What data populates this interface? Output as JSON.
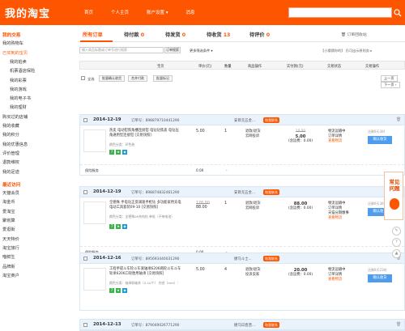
{
  "header": {
    "logo": "我的淘宝",
    "nav": [
      "首页",
      "个人主页",
      "账户设置 ▾",
      "消息"
    ],
    "search_placeholder": ""
  },
  "sidebar": [
    {
      "label": "我的交易",
      "kind": "sec"
    },
    {
      "label": "我的购物车",
      "kind": "sub0"
    },
    {
      "label": "已买到的宝贝",
      "kind": "act"
    },
    {
      "label": "我的拍卖",
      "kind": "sub"
    },
    {
      "label": "机票酒店保险",
      "kind": "sub"
    },
    {
      "label": "我的彩票",
      "kind": "sub"
    },
    {
      "label": "我的游戏",
      "kind": "sub"
    },
    {
      "label": "我的电子书",
      "kind": "sub"
    },
    {
      "label": "我的理财",
      "kind": "sub"
    },
    {
      "label": "购买过的店铺",
      "kind": "sub0"
    },
    {
      "label": "我的收藏",
      "kind": "sub0"
    },
    {
      "label": "我的积分",
      "kind": "sub0"
    },
    {
      "label": "我的优惠信息",
      "kind": "sub0"
    },
    {
      "label": "评价管理",
      "kind": "sub0"
    },
    {
      "label": "退款维权",
      "kind": "sub0"
    },
    {
      "label": "我的足迹",
      "kind": "sub0"
    },
    {
      "label": "最近访问",
      "kind": "sec"
    },
    {
      "label": "天猫会员",
      "kind": "sub0"
    },
    {
      "label": "淘金币",
      "kind": "sub0"
    },
    {
      "label": "爱淘宝",
      "kind": "sub0"
    },
    {
      "label": "聚划算",
      "kind": "sub0"
    },
    {
      "label": "爱逛街",
      "kind": "sub0"
    },
    {
      "label": "天天特价",
      "kind": "sub0"
    },
    {
      "label": "淘宝旅行",
      "kind": "sub0"
    },
    {
      "label": "喵鲜生",
      "kind": "sub0"
    },
    {
      "label": "品牌街",
      "kind": "sub0"
    },
    {
      "label": "淘宝商户",
      "kind": "sub0"
    }
  ],
  "tabs": [
    {
      "label": "所有订单",
      "num": ""
    },
    {
      "label": "待付款",
      "num": "0"
    },
    {
      "label": "待发货",
      "num": "0"
    },
    {
      "label": "待收货",
      "num": "13"
    },
    {
      "label": "待评价",
      "num": "0"
    }
  ],
  "recycle_label": "订单回收站",
  "filter": {
    "placeholder": "输入商品标题或订单号进行搜索",
    "button": "订单搜索",
    "more": "更多筛选条件 ▾",
    "right": "【小猜猜你的】 仍可出示原则务 ▸"
  },
  "columns": [
    "宝贝",
    "单价(元)",
    "数量",
    "商品操作",
    "实付款(元)",
    "交易状态",
    "交易操作"
  ],
  "batch": {
    "select_all": "全选",
    "buttons": [
      "批量确认收货",
      "合并付款",
      "批量标记"
    ],
    "pager_prev": "上一页",
    "pager_next": "下一页 ›"
  },
  "orders": [
    {
      "date": "2014-12-19",
      "order_no": "订单号：898879710441290",
      "shop": "安目克五金...",
      "items": [
        {
          "name": "热卖 电动钳铁角槽连接钳 电钻钻铁盖 电钻压角通用型连接钳 [交易快照]",
          "attr": "颜色分类：环色装",
          "price_old": "",
          "price": "5.00",
          "qty": "1",
          "svc": [
            "退款/退货",
            "云网投诉"
          ],
          "paid": "5.00",
          "paid_note": "(含运费：0.00)",
          "paid_old": "10.00",
          "status": [
            "物流运输中",
            "订单详情"
          ],
          "status_red": "查看物流",
          "op_tip": "还剩9天3时",
          "op_btn": "确认收货"
        }
      ],
      "sub": {
        "label": "保险服务",
        "price": "0.00",
        "qty": "-"
      }
    },
    {
      "date": "2014-12-19",
      "order_no": "订单号：898874832461290",
      "shop": "安目克五金...",
      "items": [
        {
          "name": "全德殊 手电钻正反调速手枪钻 多功能家用充电电动工具套装09-10 [交易快照]",
          "attr": "颜色分类：全德殊09充电钻 单低（不带电池）",
          "price_old": "176.00",
          "price": "88.00",
          "qty": "1",
          "svc": [
            "退款/退货",
            "云网投诉"
          ],
          "paid": "88.00",
          "paid_note": "(含运费：0.00)",
          "paid_old": "",
          "status": [
            "物流运输中",
            "订单详情",
            "天猫分期缴事"
          ],
          "status_red": "查看物流",
          "op_tip": "还剩9天3时",
          "op_btn": "确认收货"
        }
      ],
      "sub": {
        "label": "保险服务",
        "price": "0.00",
        "qty": "-"
      }
    },
    {
      "date": "2014-12-16",
      "order_no": "订单号：895693440031290",
      "shop": "捷马斗士...",
      "items": [
        {
          "name": "工程手搓斗车轮斗车滚轴承6206两轮斗车斗车轮承6206口轮胎用轴承 [交易快照]",
          "attr": "颜色分类：轴承斜轴承（2-10个） 内径（mm）：",
          "price_old": "",
          "price": "5.00",
          "qty": "4",
          "svc": [
            "退款/退货",
            "投诉卖家"
          ],
          "paid": "20.00",
          "paid_note": "(含运费：0.00)",
          "paid_old": "",
          "status": [
            "物流运输中",
            "订单详情"
          ],
          "status_red": "查看物流",
          "op_tip": "还剩9天23时",
          "op_btn": "确认收货"
        }
      ],
      "sub": null
    },
    {
      "date": "2014-12-13",
      "order_no": "订单号：879049026771290",
      "shop": "捷马日直营..."
    }
  ],
  "float_ad": {
    "text": "常见问题"
  },
  "colors": {
    "brand": "#fe5500",
    "button": "#4d9ced",
    "order_head": "#eaf3fc"
  }
}
